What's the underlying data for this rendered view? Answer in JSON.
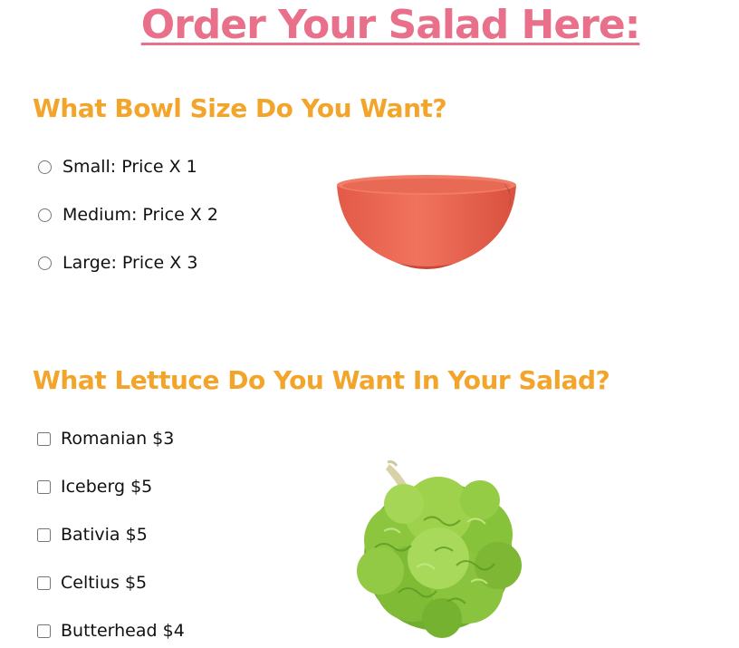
{
  "page": {
    "title": "Order Your Salad Here:"
  },
  "bowl_section": {
    "heading": "What Bowl Size Do You Want?",
    "options": [
      {
        "label": "Small: Price X 1"
      },
      {
        "label": "Medium: Price X 2"
      },
      {
        "label": "Large: Price X 3"
      }
    ],
    "image_icon": "red-bowl-image"
  },
  "lettuce_section": {
    "heading": "What Lettuce Do You Want In Your Salad?",
    "options": [
      {
        "label": "Romanian $3"
      },
      {
        "label": "Iceberg $5"
      },
      {
        "label": "Bativia $5"
      },
      {
        "label": "Celtius $5"
      },
      {
        "label": "Butterhead $4"
      }
    ],
    "image_icon": "lettuce-image"
  },
  "colors": {
    "title": "#e8708a",
    "heading": "#f2a52a",
    "bowl": "#ec6a55",
    "lettuce": "#7cbf3a"
  }
}
